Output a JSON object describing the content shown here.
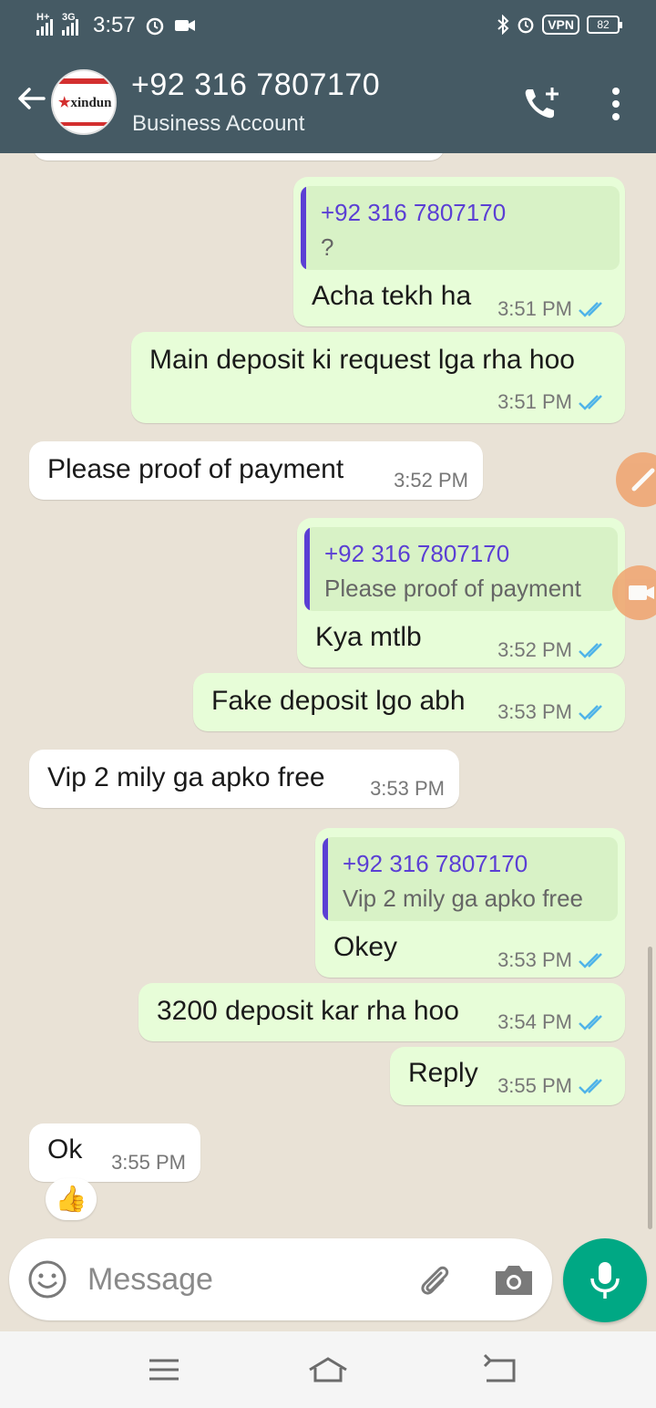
{
  "status_bar": {
    "net1": "H+",
    "net2": "3G",
    "time": "3:57",
    "vpn": "VPN",
    "battery": "82"
  },
  "header": {
    "contact": "+92 316 7807170",
    "subtitle": "Business Account",
    "avatar_logo": "xindun"
  },
  "messages": [
    {
      "dir": "out",
      "quote_name": "+92 316 7807170",
      "quote_text": "?",
      "text": "Acha tekh ha",
      "time": "3:51 PM"
    },
    {
      "dir": "out",
      "text": "Main deposit ki request lga rha hoo",
      "time": "3:51 PM"
    },
    {
      "dir": "in",
      "text": "Please proof of payment",
      "time": "3:52 PM"
    },
    {
      "dir": "out",
      "quote_name": "+92 316 7807170",
      "quote_text": "Please proof of payment",
      "text": "Kya mtlb",
      "time": "3:52 PM"
    },
    {
      "dir": "out",
      "text": "Fake deposit lgo abh",
      "time": "3:53 PM"
    },
    {
      "dir": "in",
      "text": "Vip 2 mily ga apko free",
      "time": "3:53 PM"
    },
    {
      "dir": "out",
      "quote_name": "+92 316 7807170",
      "quote_text": "Vip 2 mily ga apko free",
      "text": "Okey",
      "time": "3:53 PM"
    },
    {
      "dir": "out",
      "text": "3200 deposit kar rha hoo",
      "time": "3:54 PM"
    },
    {
      "dir": "out",
      "text": "Reply",
      "time": "3:55 PM"
    },
    {
      "dir": "in",
      "text": "Ok",
      "time": "3:55 PM",
      "reaction": "👍"
    }
  ],
  "input": {
    "placeholder": "Message"
  },
  "colors": {
    "header": "#455a64",
    "outgoing": "#e7fdd8",
    "incoming": "#ffffff",
    "quote_accent": "#5b3fd4",
    "read_ticks": "#4fb3e8",
    "mic": "#00a884"
  },
  "icons": [
    "back-arrow-icon",
    "add-call-icon",
    "more-vert-icon",
    "double-check-icon",
    "emoji-icon",
    "attach-icon",
    "camera-icon",
    "mic-icon",
    "menu-icon",
    "home-icon",
    "back-nav-icon"
  ]
}
